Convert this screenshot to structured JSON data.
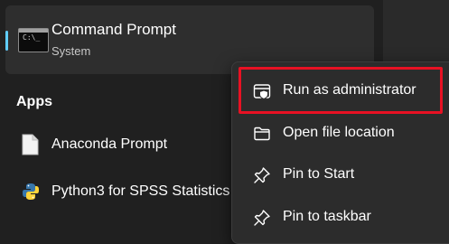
{
  "best_match": {
    "title": "Command Prompt",
    "subtitle": "System",
    "icon": "command-prompt-icon",
    "icon_glyph": "C:\\_"
  },
  "apps": {
    "heading": "Apps",
    "items": [
      {
        "label": "Anaconda Prompt",
        "icon": "document-icon"
      },
      {
        "label": "Python3 for SPSS Statistics",
        "icon": "python-icon"
      }
    ]
  },
  "context_menu": {
    "items": [
      {
        "label": "Run as administrator",
        "icon": "shield-icon"
      },
      {
        "label": "Open file location",
        "icon": "folder-icon"
      },
      {
        "label": "Pin to Start",
        "icon": "pin-icon"
      },
      {
        "label": "Pin to taskbar",
        "icon": "pin-icon"
      }
    ]
  },
  "colors": {
    "accent": "#60cdff",
    "highlight_border": "#e81123",
    "background": "#202020",
    "menu_background": "#2c2c2c"
  }
}
